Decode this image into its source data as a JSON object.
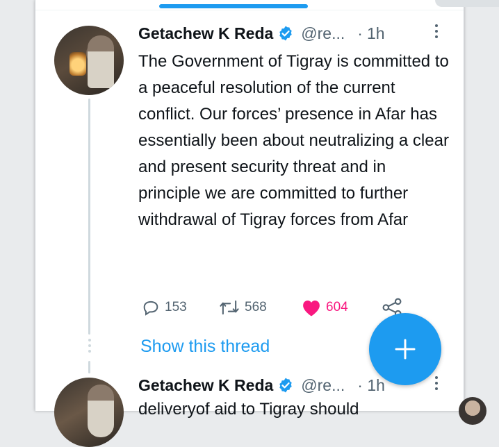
{
  "tweet": {
    "author_name": "Getachew K Reda",
    "handle": "@re...",
    "separator": "·",
    "time": "1h",
    "text": "The Government of Tigray is committed to a peaceful resolution of the current conflict. Our forces’ presence in Afar has essentially been about neutralizing a clear and present security threat and in principle we are committed to further withdrawal of Tigray forces from Afar",
    "replies": "153",
    "retweets": "568",
    "likes": "604",
    "show_thread": "Show this thread"
  },
  "next_tweet": {
    "author_name": "Getachew K Reda",
    "handle": "@re...",
    "time_partial": "· 1h",
    "text_partial": "deliveryof aid to Tigray should"
  },
  "icons": {
    "verified": "verified-badge-icon",
    "reply": "reply-icon",
    "retweet": "retweet-icon",
    "like": "heart-icon",
    "share": "share-icon",
    "compose": "plus-icon",
    "more": "more-vertical-icon"
  },
  "colors": {
    "accent": "#1d9bf0",
    "like": "#f91880",
    "text": "#0f1419",
    "muted": "#536471"
  }
}
